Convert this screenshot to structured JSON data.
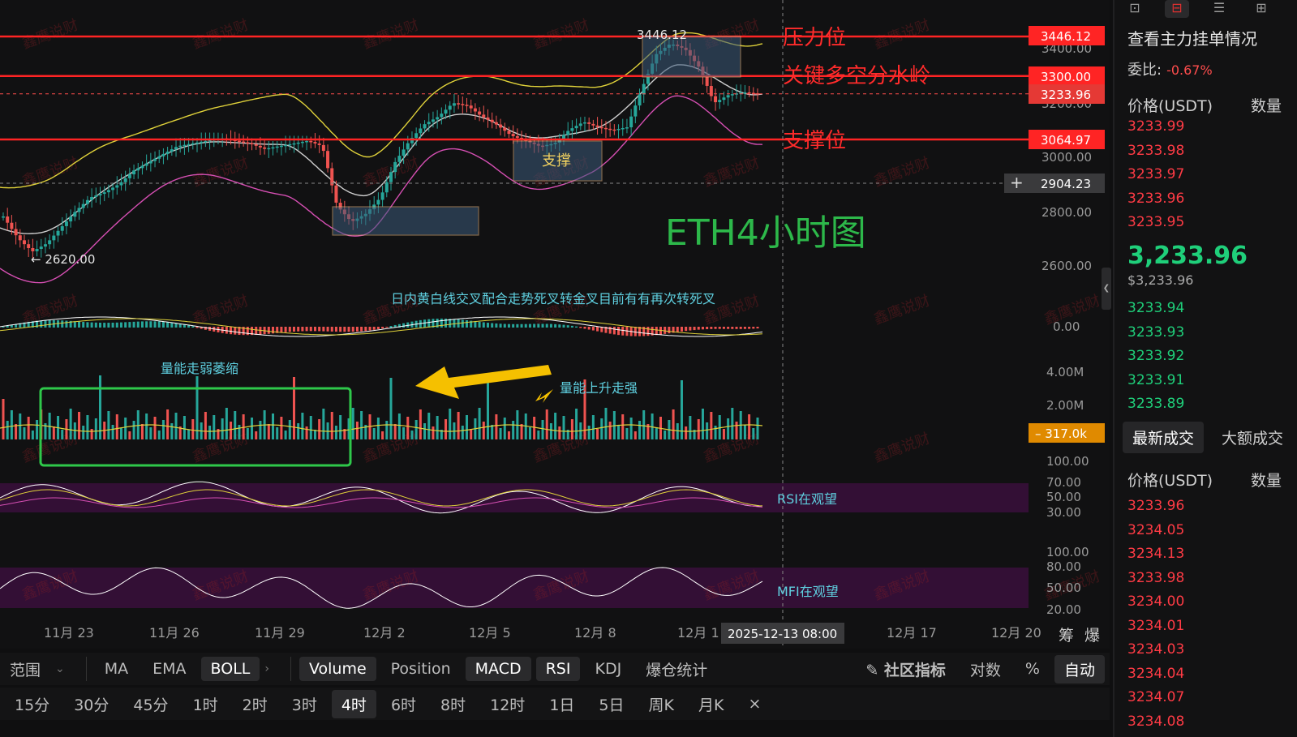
{
  "chart_title": "ETH4小时图",
  "colors": {
    "up": "#26a69a",
    "down": "#ef5350",
    "boll_upper": "#e0d23a",
    "boll_mid": "#cfcfcf",
    "boll_lower": "#d64fb3",
    "level_line": "#ff2424",
    "annotation_green": "#2db84a",
    "annotation_cyan": "#5fd0e0",
    "volume_tag": "#e08a00",
    "arrow_yellow": "#f5c000"
  },
  "levels": {
    "resistance_label": "压力位",
    "pivot_label": "关键多空分水岭",
    "support_label": "支撑位"
  },
  "price_tags": {
    "resistance": "3446.12",
    "pivot": "3300.00",
    "current": "3233.96",
    "support": "3064.97",
    "crosshair": "2904.23"
  },
  "price_axis": [
    "3400.00",
    "3200.00",
    "3000.00",
    "2800.00",
    "2600.00"
  ],
  "high_low_labels": {
    "high": "3446.12",
    "low": "2620.00"
  },
  "support_box_label": "支撑",
  "macd": {
    "axis_label": "0.00",
    "annotation": "日内黄白线交叉配合走势死叉转金叉目前有有再次转死叉"
  },
  "volume": {
    "axis_labels": [
      "4.00M",
      "2.00M"
    ],
    "current_tag": "317.0k",
    "annotation_weak": "量能走弱萎缩",
    "annotation_strong": "量能上升走强"
  },
  "rsi": {
    "axis_labels": [
      "100.00",
      "70.00",
      "50.00",
      "30.00"
    ],
    "annotation": "RSI在观望"
  },
  "mfi": {
    "axis_labels": [
      "100.00",
      "80.00",
      "50.00",
      "20.00"
    ],
    "annotation": "MFI在观望"
  },
  "dates": [
    "11月 23",
    "11月 26",
    "11月 29",
    "12月 2",
    "12月 5",
    "12月 8",
    "12月 1",
    "12月 17",
    "12月 20"
  ],
  "crosshair_time": "2025-12-13 08:00",
  "watermark": "鑫鹰说财",
  "bottom_right_labels": [
    "筹",
    "爆"
  ],
  "indicator_toolbar": {
    "range_label": "范围",
    "items": [
      "MA",
      "EMA",
      "BOLL",
      "Volume",
      "Position",
      "MACD",
      "RSI",
      "KDJ",
      "爆仓统计"
    ],
    "active": [
      "BOLL",
      "Volume",
      "MACD",
      "RSI"
    ],
    "community": "社区指标",
    "log": "对数",
    "percent": "%",
    "auto": "自动"
  },
  "timeframe_toolbar": {
    "items": [
      "15分",
      "30分",
      "45分",
      "1时",
      "2时",
      "3时",
      "4时",
      "6时",
      "8时",
      "12时",
      "1日",
      "5日",
      "周K",
      "月K"
    ],
    "active": "4时",
    "close": "×"
  },
  "order_panel": {
    "title": "查看主力挂单情况",
    "ratio_label": "委比:",
    "ratio_value": "-0.67%",
    "header_price": "价格(USDT)",
    "header_qty": "数量",
    "asks": [
      "3233.99",
      "3233.98",
      "3233.97",
      "3233.96",
      "3233.95"
    ],
    "last_price": "3,233.96",
    "last_price_usd": "$3,233.96",
    "bids": [
      "3233.94",
      "3233.93",
      "3233.92",
      "3233.91",
      "3233.89"
    ],
    "tabs": [
      "最新成交",
      "大额成交"
    ],
    "trades_header_price": "价格(USDT)",
    "trades_header_qty": "数量",
    "trades": [
      "3233.96",
      "3234.05",
      "3234.13",
      "3233.98",
      "3234.00",
      "3234.01",
      "3234.03",
      "3234.04",
      "3234.07",
      "3234.08"
    ]
  },
  "chart_data": {
    "type": "candlestick",
    "title": "ETH4小时图",
    "interval": "4时",
    "ylim": [
      2560,
      3480
    ],
    "x_dates": [
      "11月 23",
      "11月 26",
      "11月 29",
      "12月 2",
      "12月 5",
      "12月 8",
      "12月 1",
      "12月 17",
      "12月 20"
    ],
    "price_path_close": [
      2780,
      2700,
      2650,
      2680,
      2740,
      2800,
      2850,
      2870,
      2900,
      2950,
      2980,
      3010,
      3040,
      3050,
      3060,
      3070,
      3060,
      3050,
      3030,
      3040,
      3050,
      3060,
      3040,
      2820,
      2760,
      2790,
      2850,
      2980,
      3060,
      3120,
      3150,
      3200,
      3190,
      3150,
      3120,
      3080,
      3060,
      3040,
      3050,
      3100,
      3130,
      3110,
      3100,
      3110,
      3250,
      3380,
      3420,
      3400,
      3330,
      3200,
      3230,
      3240,
      3233.96
    ],
    "resistance": 3446.12,
    "pivot": 3300.0,
    "support": 3064.97,
    "current": 3233.96,
    "low_marker": 2620.0,
    "high_marker": 3446.12
  }
}
